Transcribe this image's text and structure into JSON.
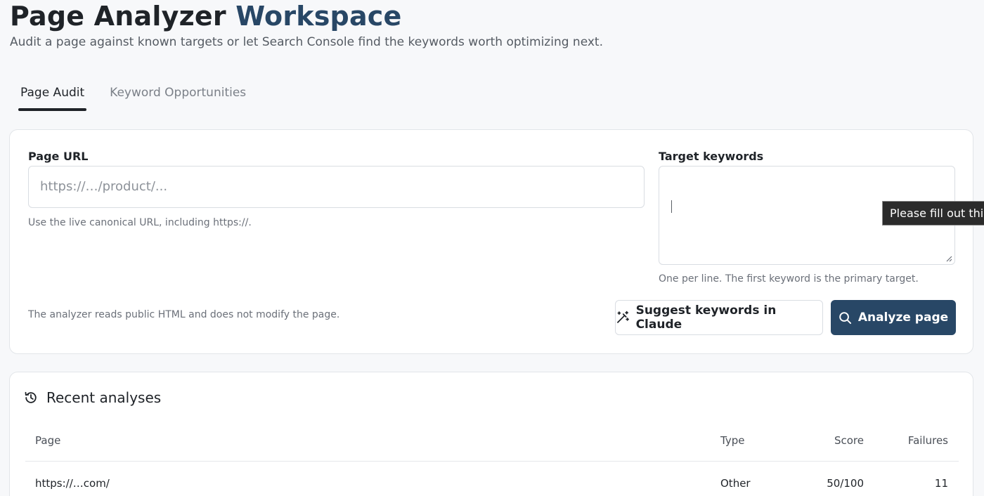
{
  "header": {
    "title_main": "Page Analyzer",
    "title_accent": "Workspace",
    "subtitle": "Audit a page against known targets or let Search Console find the keywords worth optimizing next."
  },
  "tabs": [
    {
      "label": "Page Audit",
      "active": true
    },
    {
      "label": "Keyword Opportunities",
      "active": false
    }
  ],
  "audit": {
    "url_label": "Page URL",
    "url_placeholder": "https://…/product/...",
    "url_help": "Use the live canonical URL, including https://.",
    "keywords_label": "Target keywords",
    "keywords_value": "",
    "keywords_help": "One per line. The first keyword is the primary target.",
    "validation_tooltip": "Please fill out this",
    "footer_note": "The analyzer reads public HTML and does not modify the page.",
    "suggest_button": "Suggest keywords in Claude",
    "analyze_button": "Analyze page"
  },
  "recent": {
    "title": "Recent analyses",
    "columns": [
      "Page",
      "Type",
      "Score",
      "Failures"
    ],
    "rows": [
      {
        "page": "https://…com/",
        "type": "Other",
        "score": "50/100",
        "failures": "11"
      }
    ]
  },
  "colors": {
    "accent": "#284766",
    "background": "#f7f8fa",
    "card": "#ffffff",
    "tooltip_bg": "#2b2b2b"
  },
  "icons": {
    "suggest": "magic-wand-icon",
    "analyze": "search-icon",
    "recent": "history-icon"
  }
}
